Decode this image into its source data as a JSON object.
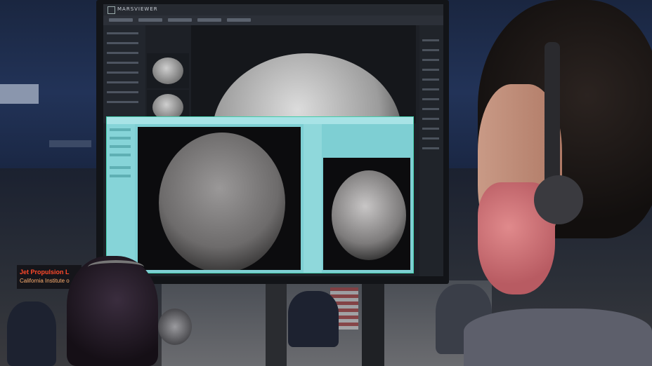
{
  "monitor": {
    "app_name": "MARSVIEWER"
  },
  "sign": {
    "line1": "Jet Propulsion L",
    "line2": "California Institute o"
  },
  "colors": {
    "dialog_bg": "#7ecfd3",
    "sign_red": "#ff4a2a",
    "mask": "#d0767c"
  }
}
